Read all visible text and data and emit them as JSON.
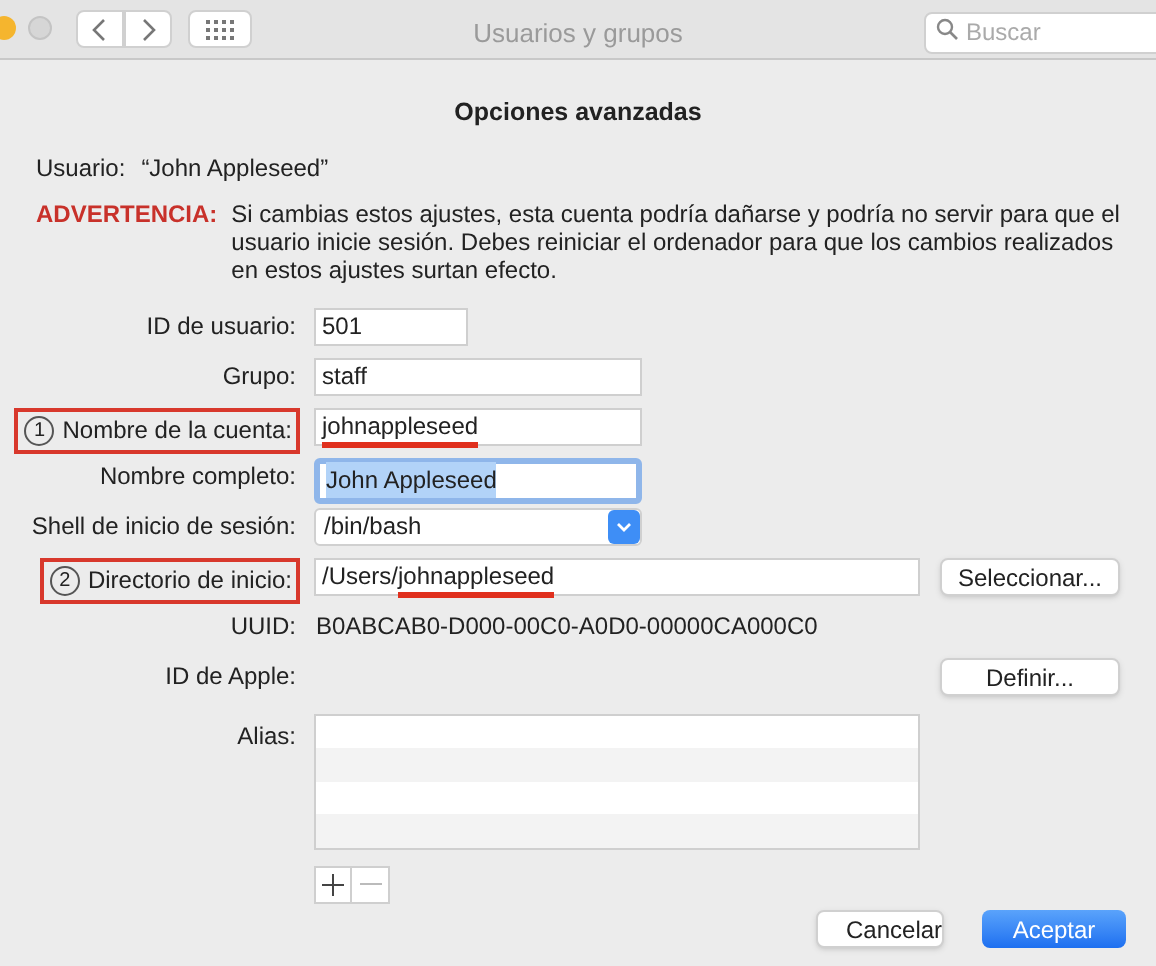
{
  "window": {
    "title": "Usuarios y grupos"
  },
  "search": {
    "placeholder": "Buscar"
  },
  "dialog": {
    "title": "Opciones avanzadas",
    "user_label": "Usuario:",
    "user_value": "“John Appleseed”",
    "warning": {
      "label": "ADVERTENCIA:",
      "text": "Si cambias estos ajustes, esta cuenta podría dañarse y podría no servir para que el usuario inicie sesión. Debes reiniciar el ordenador para que los cambios realizados en estos ajustes surtan efecto."
    },
    "fields": [
      {
        "kind": "number",
        "label": "ID de usuario:",
        "parts": [
          {
            "text": "501",
            "underlined": false
          }
        ],
        "highlighted": false,
        "focused": false
      },
      {
        "kind": "text",
        "label": "Grupo:",
        "parts": [
          {
            "text": "staff",
            "underlined": false
          }
        ],
        "highlighted": false,
        "focused": false
      },
      {
        "kind": "text",
        "label": "Nombre de la cuenta:",
        "callout": "1",
        "parts": [
          {
            "text": "johnappleseed",
            "underlined": true
          }
        ],
        "highlighted": true,
        "focused": false
      },
      {
        "kind": "text",
        "label": "Nombre completo:",
        "parts": [
          {
            "text": "John Appleseed",
            "underlined": false
          }
        ],
        "highlighted": false,
        "focused": true
      },
      {
        "kind": "popup",
        "label": "Shell de inicio de sesión:",
        "value": "/bin/bash"
      },
      {
        "kind": "path",
        "label": "Directorio de inicio:",
        "callout": "2",
        "parts": [
          {
            "text": "/Users/",
            "underlined": false
          },
          {
            "text": "johnappleseed",
            "underlined": true
          }
        ],
        "highlighted": true,
        "focused": false,
        "button": "Seleccionar..."
      },
      {
        "kind": "readonly",
        "label": "UUID:",
        "value": "B0ABCAB0-D000-00C0-A0D0-00000CA000C0"
      },
      {
        "kind": "button",
        "label": "ID de Apple:",
        "button": "Definir..."
      },
      {
        "kind": "list",
        "label": "Alias:"
      }
    ],
    "buttons": [
      {
        "label": "Cancelar",
        "default": false
      },
      {
        "label": "Aceptar",
        "default": true
      }
    ]
  }
}
